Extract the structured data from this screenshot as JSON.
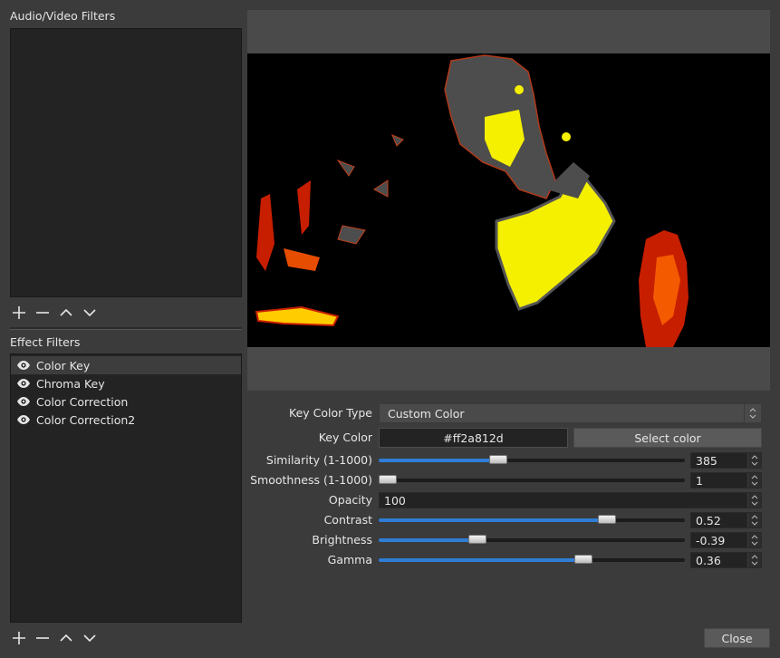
{
  "left": {
    "av_filters_title": "Audio/Video Filters",
    "effect_filters_title": "Effect Filters",
    "effect_filters": [
      {
        "label": "Color Key",
        "selected": true
      },
      {
        "label": "Chroma Key",
        "selected": false
      },
      {
        "label": "Color Correction",
        "selected": false
      },
      {
        "label": "Color Correction2",
        "selected": false
      }
    ]
  },
  "properties": {
    "key_color_type": {
      "label": "Key Color Type",
      "value": "Custom Color"
    },
    "key_color": {
      "label": "Key Color",
      "value": "#ff2a812d",
      "button": "Select color"
    },
    "similarity": {
      "label": "Similarity (1-1000)",
      "value": "385",
      "fraction": 0.385
    },
    "smoothness": {
      "label": "Smoothness (1-1000)",
      "value": "1",
      "fraction": 0.0
    },
    "opacity": {
      "label": "Opacity",
      "value": "100"
    },
    "contrast": {
      "label": "Contrast",
      "value": "0.52",
      "fraction": 0.76
    },
    "brightness": {
      "label": "Brightness",
      "value": "-0.39",
      "fraction": 0.31
    },
    "gamma": {
      "label": "Gamma",
      "value": "0.36",
      "fraction": 0.68
    }
  },
  "footer": {
    "close": "Close"
  },
  "colors": {
    "accent": "#2f7dd6",
    "key_yellow": "#ffff00",
    "key_red": "#ff2a00"
  }
}
